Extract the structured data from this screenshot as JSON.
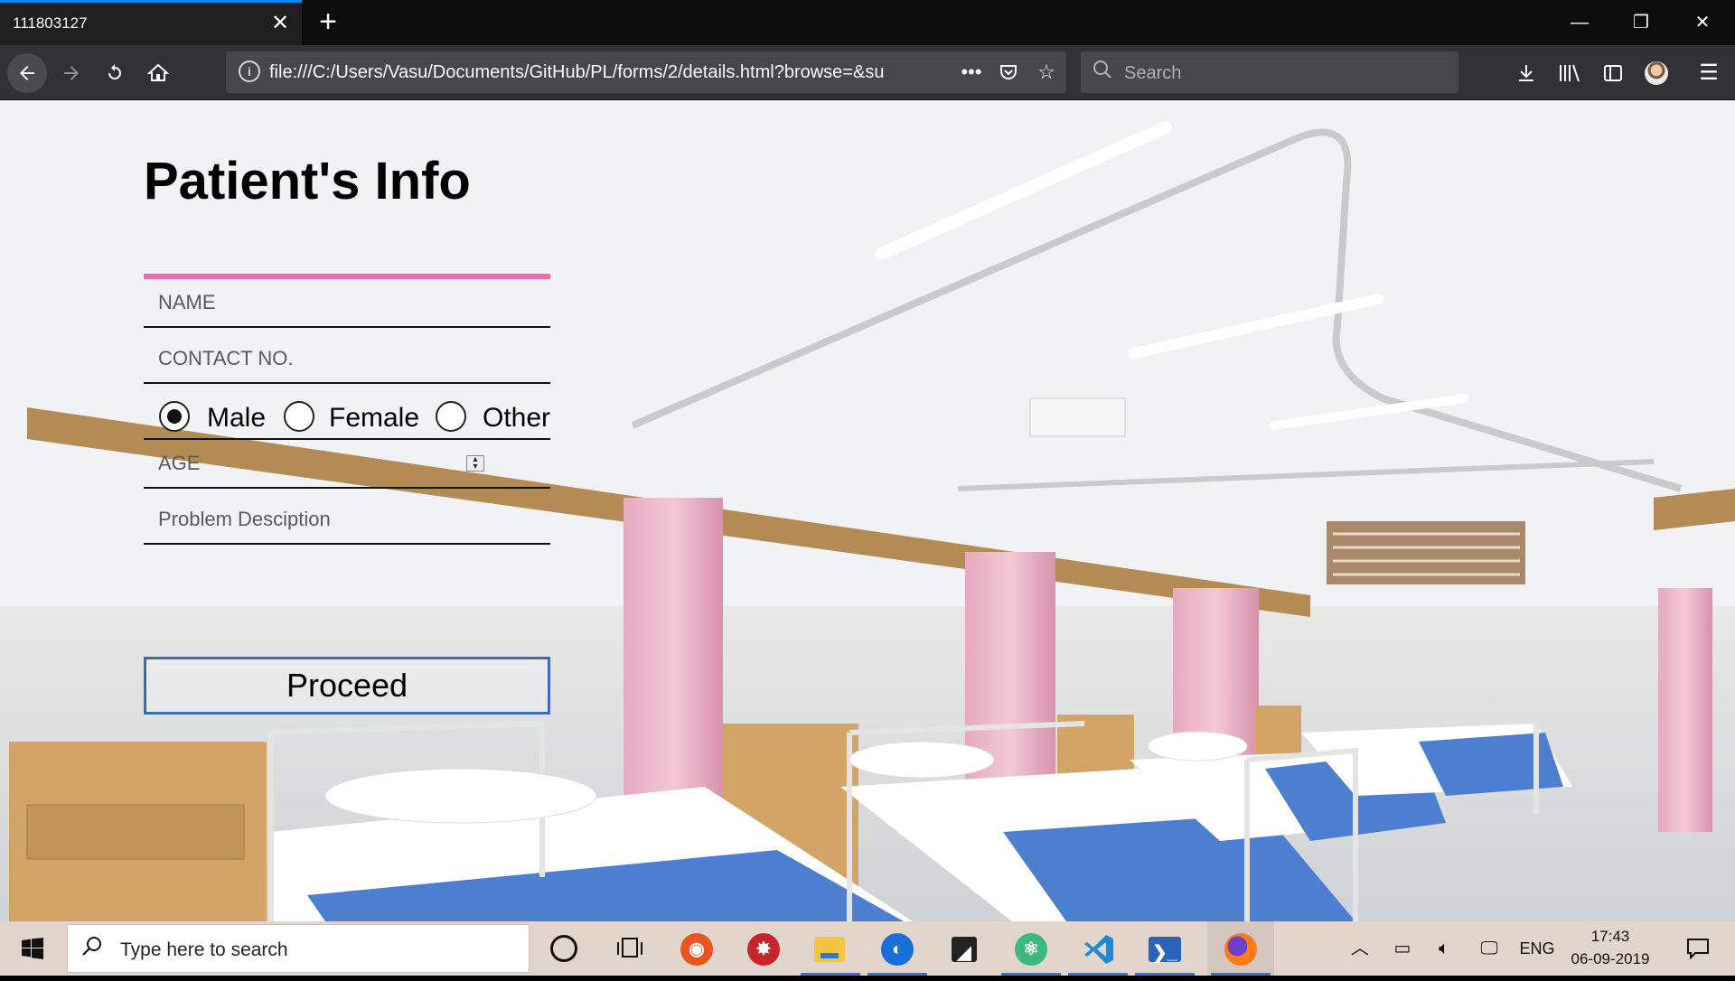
{
  "browser": {
    "tab_title": "111803127",
    "tab_close": "✕",
    "new_tab": "+",
    "window_controls": [
      "—",
      "❐",
      "✕"
    ],
    "url": "file:///C:/Users/Vasu/Documents/GitHub/PL/forms/2/details.html?browse=&su",
    "search_placeholder": "Search",
    "page_actions": "•••"
  },
  "form": {
    "title": "Patient's Info",
    "name_placeholder": "NAME",
    "contact_placeholder": "CONTACT NO.",
    "gender": {
      "options": [
        "Male",
        "Female",
        "Other"
      ],
      "selected": "Male"
    },
    "age_placeholder": "AGE",
    "problem_placeholder": "Problem Desciption",
    "proceed_label": "Proceed"
  },
  "colors": {
    "title_underline": "#f06aa7",
    "button_border": "#3c6cb4"
  },
  "taskbar": {
    "search_text": "Type here to search",
    "language": "ENG",
    "time": "17:43",
    "date": "06-09-2019",
    "pinned_apps": [
      "cortana-icon",
      "task-view-icon",
      "ubuntu-icon",
      "app-red-icon",
      "file-explorer-icon",
      "firefox-dev-icon",
      "sticky-notes-icon",
      "atom-icon",
      "vscode-icon",
      "powershell-icon",
      "firefox-icon"
    ]
  }
}
